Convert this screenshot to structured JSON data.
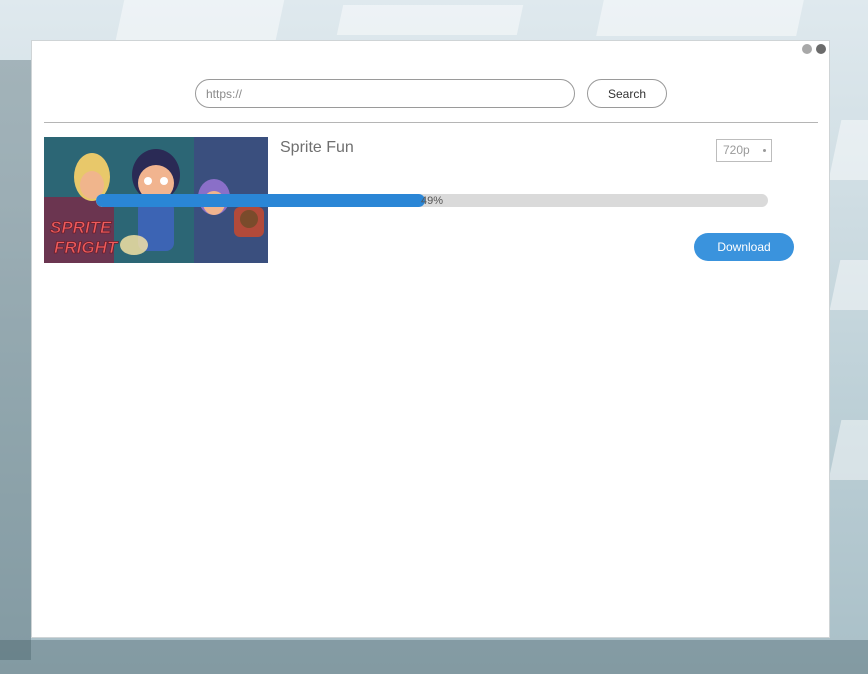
{
  "window": {
    "controls": {
      "minimize_icon": "circle-gray",
      "close_icon": "circle-dark"
    }
  },
  "search": {
    "placeholder": "https://",
    "value": "",
    "button_label": "Search"
  },
  "video": {
    "title": "Sprite Fun",
    "quality": "720p",
    "progress_label": "49%",
    "progress": 0.49,
    "download_label": "Download",
    "thumbnail_logo": "SPRITE FRIGHT"
  },
  "colors": {
    "accent": "#3a93dd",
    "progress_fill": "#2a86d6",
    "progress_track": "#dadada"
  }
}
